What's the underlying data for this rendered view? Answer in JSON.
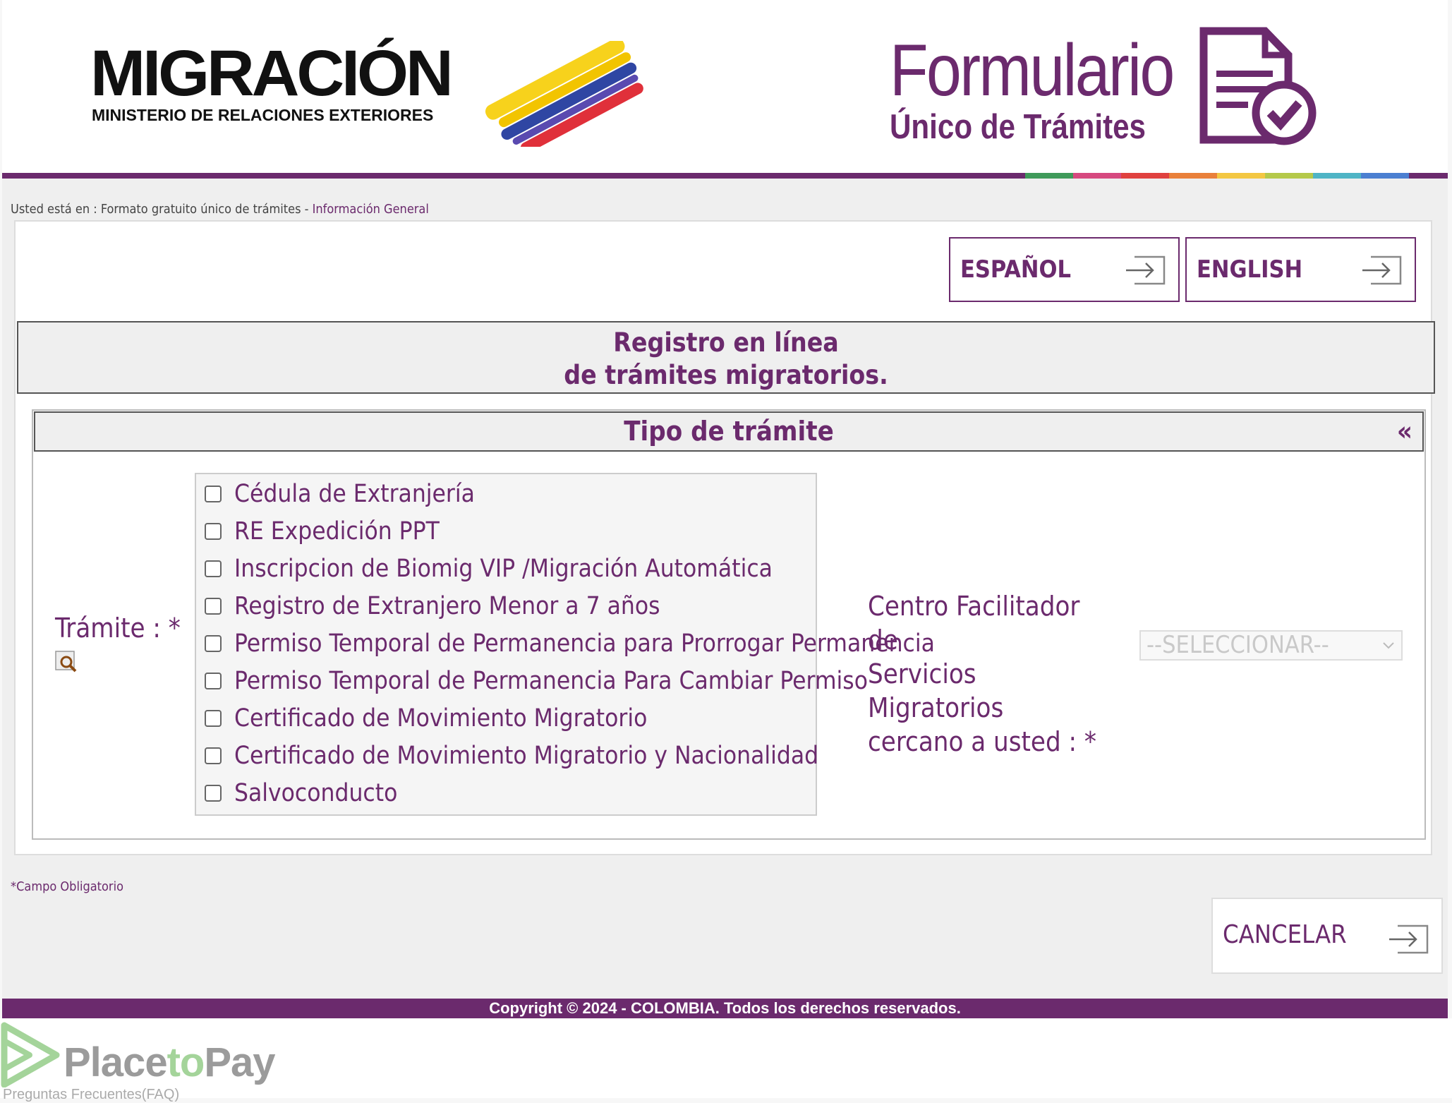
{
  "header": {
    "logo_left": {
      "word": "MIGRACIÓN",
      "subtitle": "MINISTERIO DE RELACIONES EXTERIORES"
    },
    "logo_right": {
      "line1": "Formulario",
      "line2": "Único de Trámites"
    },
    "rainbow_colors": [
      "#3f9a5a",
      "#d6497f",
      "#e0413f",
      "#e9803a",
      "#f3c742",
      "#b5c94a",
      "#4fb4c5",
      "#4b7fd1"
    ]
  },
  "breadcrumb": {
    "prefix": "Usted está en : Formato gratuito único de trámites - ",
    "current": "Información General"
  },
  "language": {
    "spanish": "ESPAÑOL",
    "english": "ENGLISH"
  },
  "registro_title": {
    "line1": "Registro en línea",
    "line2": "de trámites migratorios."
  },
  "section": {
    "title": "Tipo de trámite",
    "collapse": "«"
  },
  "form": {
    "tramite_label": "Trámite : *",
    "tramite_options": [
      "Cédula de Extranjería",
      "RE Expedición PPT",
      "Inscripcion de Biomig VIP /Migración Automática",
      "Registro de Extranjero Menor a 7 años",
      "Permiso Temporal de Permanencia para Prorrogar Permanencia",
      "Permiso Temporal de Permanencia Para Cambiar Permiso",
      "Certificado de Movimiento Migratorio",
      "Certificado de Movimiento Migratorio y Nacionalidad",
      "Salvoconducto"
    ],
    "centro_label_lines": [
      "Centro Facilitador de",
      "Servicios Migratorios",
      "cercano a usted : *"
    ],
    "centro_select_value": "--SELECCIONAR--"
  },
  "required_note": "*Campo Obligatorio",
  "cancel_label": "CANCELAR",
  "footer": "Copyright © 2024 - COLOMBIA. Todos los derechos reservados.",
  "placetopay": {
    "place": "Place",
    "to": "to",
    "pay": "Pay"
  },
  "faq": "Preguntas Frecuentes(FAQ)",
  "colors": {
    "brand_purple": "#6b2a6d",
    "ptp_green": "#a4d49a"
  }
}
